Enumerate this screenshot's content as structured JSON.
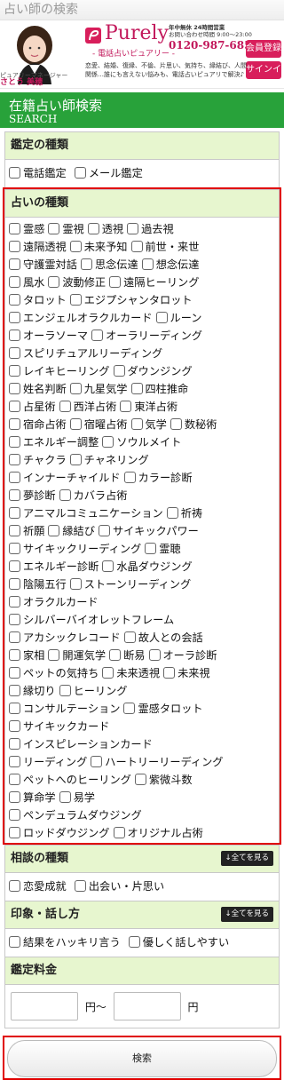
{
  "top_title": "占い師の検索",
  "banner": {
    "avatar_caption_small": "ピュアリーマネージャー",
    "avatar_caption_name": "さとう 美穂",
    "logo": "Purely",
    "logo_sub": "- 電話占いピュアリー -",
    "hours_line1": "年中無休 24時間営業",
    "hours_line2": "お問い合わせ時間 9:00～23:00",
    "phone": "0120-987-685",
    "register_label": "会員登録",
    "signin_label": "サインイン",
    "tagline": "恋愛、結婚、復縁、不倫、片思い、気持ち、縁結び、人間関係…誰にも言えない悩みも、電話占いピュアリで解決♪"
  },
  "header": {
    "title": "在籍占い師検索",
    "subtitle": "SEARCH"
  },
  "appraisal": {
    "heading": "鑑定の種類",
    "options": [
      "電話鑑定",
      "メール鑑定"
    ]
  },
  "fortune": {
    "heading": "占いの種類",
    "rows": [
      [
        "霊感",
        "霊視",
        "透視",
        "過去視"
      ],
      [
        "遠隔透視",
        "未来予知",
        "前世・来世"
      ],
      [
        "守護霊対話",
        "思念伝達",
        "想念伝達"
      ],
      [
        "風水",
        "波動修正",
        "遠隔ヒーリング"
      ],
      [
        "タロット",
        "エジプシャンタロット"
      ],
      [
        "エンジェルオラクルカード",
        "ルーン"
      ],
      [
        "オーラソーマ",
        "オーラリーディング"
      ],
      [
        "スピリチュアルリーディング"
      ],
      [
        "レイキヒーリング",
        "ダウンジング"
      ],
      [
        "姓名判断",
        "九星気学",
        "四柱推命"
      ],
      [
        "占星術",
        "西洋占術",
        "東洋占術"
      ],
      [
        "宿命占術",
        "宿曜占術",
        "気学",
        "数秘術"
      ],
      [
        "エネルギー調整",
        "ソウルメイト"
      ],
      [
        "チャクラ",
        "チャネリング"
      ],
      [
        "インナーチャイルド",
        "カラー診断"
      ],
      [
        "夢診断",
        "カバラ占術"
      ],
      [
        "アニマルコミュニケーション",
        "祈祷"
      ],
      [
        "祈願",
        "縁結び",
        "サイキックパワー"
      ],
      [
        "サイキックリーディング",
        "霊聴"
      ],
      [
        "エネルギー診断",
        "水晶ダウジング"
      ],
      [
        "陰陽五行",
        "ストーンリーディング"
      ],
      [
        "オラクルカード"
      ],
      [
        "シルバーバイオレットフレーム"
      ],
      [
        "アカシックレコード",
        "故人との会話"
      ],
      [
        "家相",
        "開運気学",
        "断易",
        "オーラ診断"
      ],
      [
        "ペットの気持ち",
        "未来透視",
        "未来視"
      ],
      [
        "縁切り",
        "ヒーリング"
      ],
      [
        "コンサルテーション",
        "霊感タロット"
      ],
      [
        "サイキックカード"
      ],
      [
        "インスピレーションカード"
      ],
      [
        "リーディング",
        "ハートリーリーディング"
      ],
      [
        "ペットへのヒーリング",
        "紫微斗数"
      ],
      [
        "算命学",
        "易学"
      ],
      [
        "ペンデュラムダウジング"
      ],
      [
        "ロッドダウジング",
        "オリジナル占術"
      ]
    ]
  },
  "consult": {
    "heading": "相談の種類",
    "see_all": "↓全てを見る",
    "options": [
      "恋愛成就",
      "出会い・片思い"
    ]
  },
  "impression": {
    "heading": "印象・話し方",
    "see_all": "↓全てを見る",
    "options": [
      "結果をハッキリ言う",
      "優しく話しやすい"
    ]
  },
  "fee": {
    "heading": "鑑定料金",
    "sep": "円～",
    "unit": "円"
  },
  "search": {
    "label": "検索"
  },
  "colors": {
    "green": "#28a23a",
    "pink": "#d81e5b",
    "highlight_red": "#e00000",
    "section_bg": "#e7f6cf"
  }
}
